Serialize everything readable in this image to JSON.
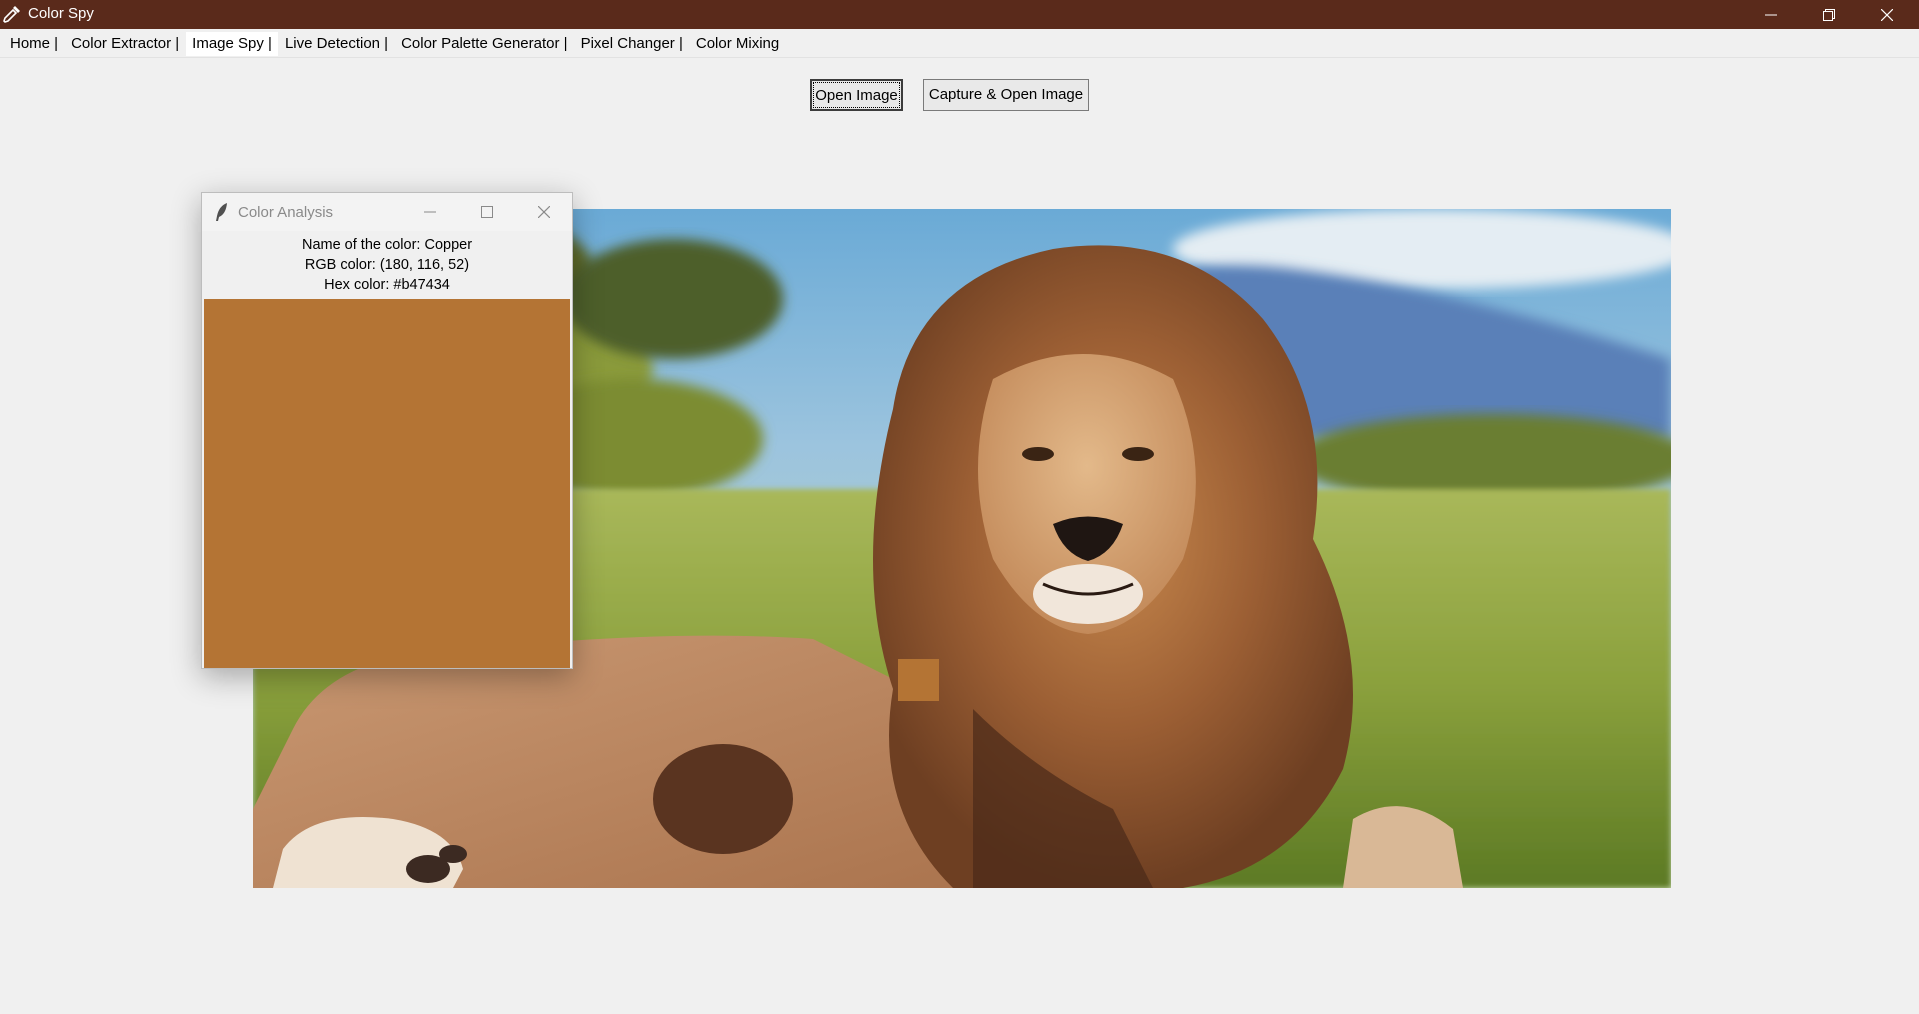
{
  "window": {
    "title": "Color Spy",
    "icon": "eyedropper-icon",
    "controls": [
      "minimize-icon",
      "restore-icon",
      "close-icon"
    ],
    "title_bar_color": "#5a2a1b"
  },
  "menu": {
    "tabs": [
      {
        "label": "Home |",
        "active": false
      },
      {
        "label": "Color Extractor |",
        "active": false
      },
      {
        "label": "Image Spy |",
        "active": true
      },
      {
        "label": "Live Detection |",
        "active": false
      },
      {
        "label": "Color Palette Generator |",
        "active": false
      },
      {
        "label": "Pixel Changer |",
        "active": false
      },
      {
        "label": "Color Mixing",
        "active": false
      }
    ]
  },
  "toolbar": {
    "open_label": "Open Image",
    "capture_label": "Capture & Open Image"
  },
  "image": {
    "subject": "lion-photo",
    "picked_color": "#b47434"
  },
  "popup": {
    "title": "Color Analysis",
    "icon": "feather-icon",
    "name_line": "Name of the color: Copper",
    "rgb_line": "RGB color: (180, 116, 52)",
    "hex_line": "Hex color: #b47434",
    "swatch_color": "#b47434"
  }
}
